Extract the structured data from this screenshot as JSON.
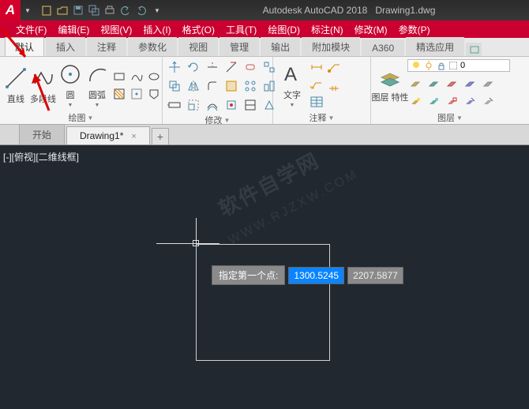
{
  "title": {
    "app": "Autodesk AutoCAD 2018",
    "file": "Drawing1.dwg"
  },
  "menu": [
    "文件(F)",
    "编辑(E)",
    "视图(V)",
    "插入(I)",
    "格式(O)",
    "工具(T)",
    "绘图(D)",
    "标注(N)",
    "修改(M)",
    "参数(P)"
  ],
  "ribbon_tabs": [
    "默认",
    "插入",
    "注释",
    "参数化",
    "视图",
    "管理",
    "输出",
    "附加模块",
    "A360",
    "精选应用"
  ],
  "panels": {
    "draw": {
      "title": "绘图",
      "line": "直线",
      "polyline": "多段线",
      "circle": "圆",
      "arc": "圆弧"
    },
    "modify": {
      "title": "修改"
    },
    "annotate": {
      "title": "注释",
      "text": "文字"
    },
    "layer": {
      "title": "图层",
      "layerprop": "图层\n特性",
      "unsaved": "0"
    }
  },
  "doc_tabs": {
    "start": "开始",
    "drawing": "Drawing1*"
  },
  "viewport_label": "[-][俯视][二维线框]",
  "prompt": "指定第一个点:",
  "coord_x": "1300.5245",
  "coord_y": "2207.5877",
  "watermark1": "软件自学网",
  "watermark2": "WWW.RJZXW.COM"
}
